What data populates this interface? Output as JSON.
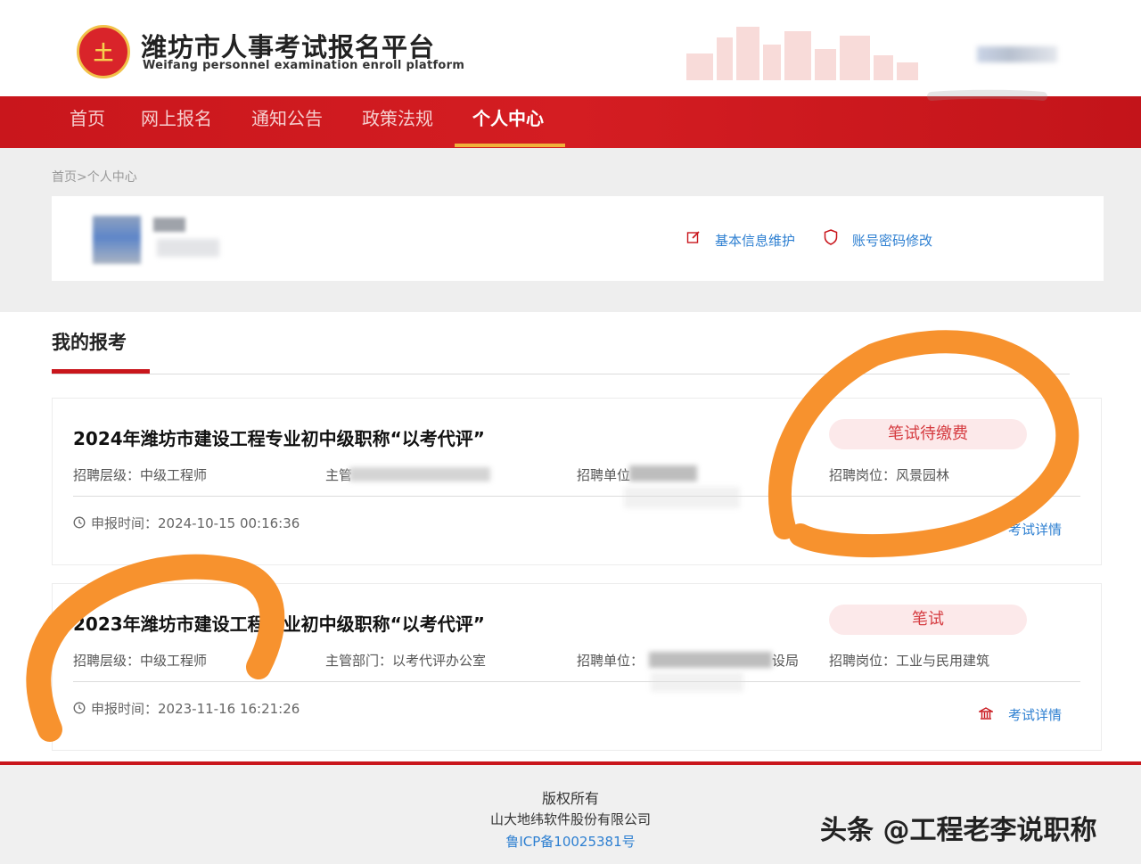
{
  "header": {
    "logo_mark": "土",
    "title": "潍坊市人事考试报名平台",
    "subtitle": "Weifang personnel examination enroll platform"
  },
  "nav": {
    "items": [
      "首页",
      "网上报名",
      "通知公告",
      "政策法规",
      "个人中心"
    ],
    "active_index": 4
  },
  "breadcrumb": "首页>个人中心",
  "profile": {
    "basic_info_link": "基本信息维护",
    "password_link": "账号密码修改"
  },
  "section": {
    "title": "我的报考"
  },
  "exams": [
    {
      "title": "2024年潍坊市建设工程专业初中级职称“以考代评”",
      "status": "笔试待缴费",
      "level": "招聘层级：中级工程师",
      "dept": "主管",
      "unit": "招聘单位",
      "post": "招聘岗位：风景园林",
      "time": "申报时间：2024-10-15 00:16:36",
      "detail_link": "考试详情"
    },
    {
      "title": "2023年潍坊市建设工程专业初中级职称“以考代评”",
      "status": "笔试",
      "level": "招聘层级：中级工程师",
      "dept": "主管部门：以考代评办公室",
      "unit": "招聘单位：",
      "unit_suffix": "设局",
      "post": "招聘岗位：工业与民用建筑",
      "time": "申报时间：2023-11-16 16:21:26",
      "detail_link": "考试详情"
    }
  ],
  "footer": {
    "copyright": "版权所有",
    "company": "山大地纬软件股份有限公司",
    "icp": "鲁ICP备10025381号"
  },
  "watermark": "头条 @工程老李说职称",
  "colors": {
    "brand_red": "#c9161c",
    "accent_gold": "#f0b23b",
    "link_blue": "#2d7fd1",
    "status_pink_bg": "#fce9ea",
    "marker_orange": "#f7922e"
  }
}
